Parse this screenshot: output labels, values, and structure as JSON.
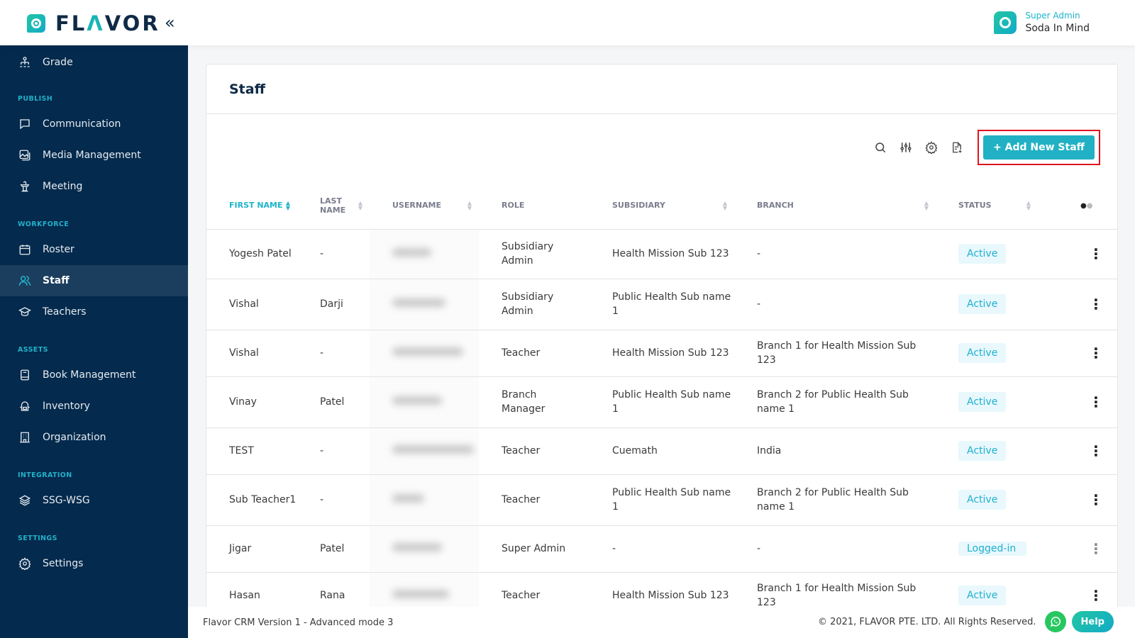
{
  "app": {
    "brand": "FLAVOR",
    "collapse_icon": "double-chevron-left-icon"
  },
  "user": {
    "role": "Super Admin",
    "name": "Soda In Mind"
  },
  "sidebar": {
    "top_items": [
      {
        "label": "Grade",
        "icon": "hierarchy-icon"
      }
    ],
    "sections": [
      {
        "title": "PUBLISH",
        "items": [
          {
            "label": "Communication",
            "icon": "chat-icon"
          },
          {
            "label": "Media Management",
            "icon": "media-icon"
          },
          {
            "label": "Meeting",
            "icon": "podium-icon"
          }
        ]
      },
      {
        "title": "WORKFORCE",
        "items": [
          {
            "label": "Roster",
            "icon": "calendar-icon"
          },
          {
            "label": "Staff",
            "icon": "users-icon",
            "active": true
          },
          {
            "label": "Teachers",
            "icon": "graduation-cap-icon"
          }
        ]
      },
      {
        "title": "ASSETS",
        "items": [
          {
            "label": "Book Management",
            "icon": "book-icon"
          },
          {
            "label": "Inventory",
            "icon": "backpack-icon"
          },
          {
            "label": "Organization",
            "icon": "building-icon"
          }
        ]
      },
      {
        "title": "INTEGRATION",
        "items": [
          {
            "label": "SSG-WSG",
            "icon": "layers-icon"
          }
        ]
      },
      {
        "title": "SETTINGS",
        "items": [
          {
            "label": "Settings",
            "icon": "gear-icon"
          }
        ]
      }
    ]
  },
  "page": {
    "title": "Staff",
    "add_button": "+ Add New Staff",
    "toolbar_icons": [
      "search-icon",
      "filter-sliders-icon",
      "gear-icon",
      "export-file-icon"
    ]
  },
  "table": {
    "columns": [
      {
        "label": "FIRST NAME",
        "sortable": true,
        "sorted": true
      },
      {
        "label": "LAST NAME",
        "sortable": true
      },
      {
        "label": "USERNAME",
        "sortable": true
      },
      {
        "label": "ROLE",
        "sortable": false
      },
      {
        "label": "SUBSIDIARY",
        "sortable": true
      },
      {
        "label": "BRANCH",
        "sortable": true
      },
      {
        "label": "STATUS",
        "sortable": true
      },
      {
        "label": "",
        "sortable": false
      }
    ],
    "rows": [
      {
        "first": "Yogesh Patel",
        "last": "-",
        "username": "[blurred]",
        "role": "Subsidiary Admin",
        "subsidiary": "Health Mission Sub 123",
        "branch": "-",
        "status": "Active"
      },
      {
        "first": "Vishal",
        "last": "Darji",
        "username": "[blurred]",
        "role": "Subsidiary Admin",
        "subsidiary": "Public Health Sub name 1",
        "branch": "-",
        "status": "Active"
      },
      {
        "first": "Vishal",
        "last": "-",
        "username": "[blurred]",
        "role": "Teacher",
        "subsidiary": "Health Mission Sub 123",
        "branch": "Branch 1 for Health Mission Sub 123",
        "status": "Active"
      },
      {
        "first": "Vinay",
        "last": "Patel",
        "username": "[blurred]",
        "role": "Branch Manager",
        "subsidiary": "Public Health Sub name 1",
        "branch": "Branch 2 for Public Health Sub name 1",
        "status": "Active"
      },
      {
        "first": "TEST",
        "last": "-",
        "username": "[blurred]",
        "role": "Teacher",
        "subsidiary": "Cuemath",
        "branch": "India",
        "status": "Active"
      },
      {
        "first": "Sub Teacher1",
        "last": "-",
        "username": "[blurred]",
        "role": "Teacher",
        "subsidiary": "Public Health Sub name 1",
        "branch": "Branch 2 for Public Health Sub name 1",
        "status": "Active"
      },
      {
        "first": "Jigar",
        "last": "Patel",
        "username": "[blurred]",
        "role": "Super Admin",
        "subsidiary": "-",
        "branch": "-",
        "status": "Logged-in"
      },
      {
        "first": "Hasan",
        "last": "Rana",
        "username": "[blurred]",
        "role": "Teacher",
        "subsidiary": "Health Mission Sub 123",
        "branch": "Branch 1 for Health Mission Sub 123",
        "status": "Active"
      }
    ]
  },
  "footer": {
    "version": "Flavor CRM Version 1 - Advanced mode 3",
    "copyright": "© 2021, FLAVOR PTE. LTD. All Rights Reserved.",
    "help": "Help"
  },
  "colors": {
    "sidebar_bg": "#042a4d",
    "accent": "#22b1c4",
    "highlight_border": "#e0141e",
    "status_bg": "#e8f8fc"
  }
}
